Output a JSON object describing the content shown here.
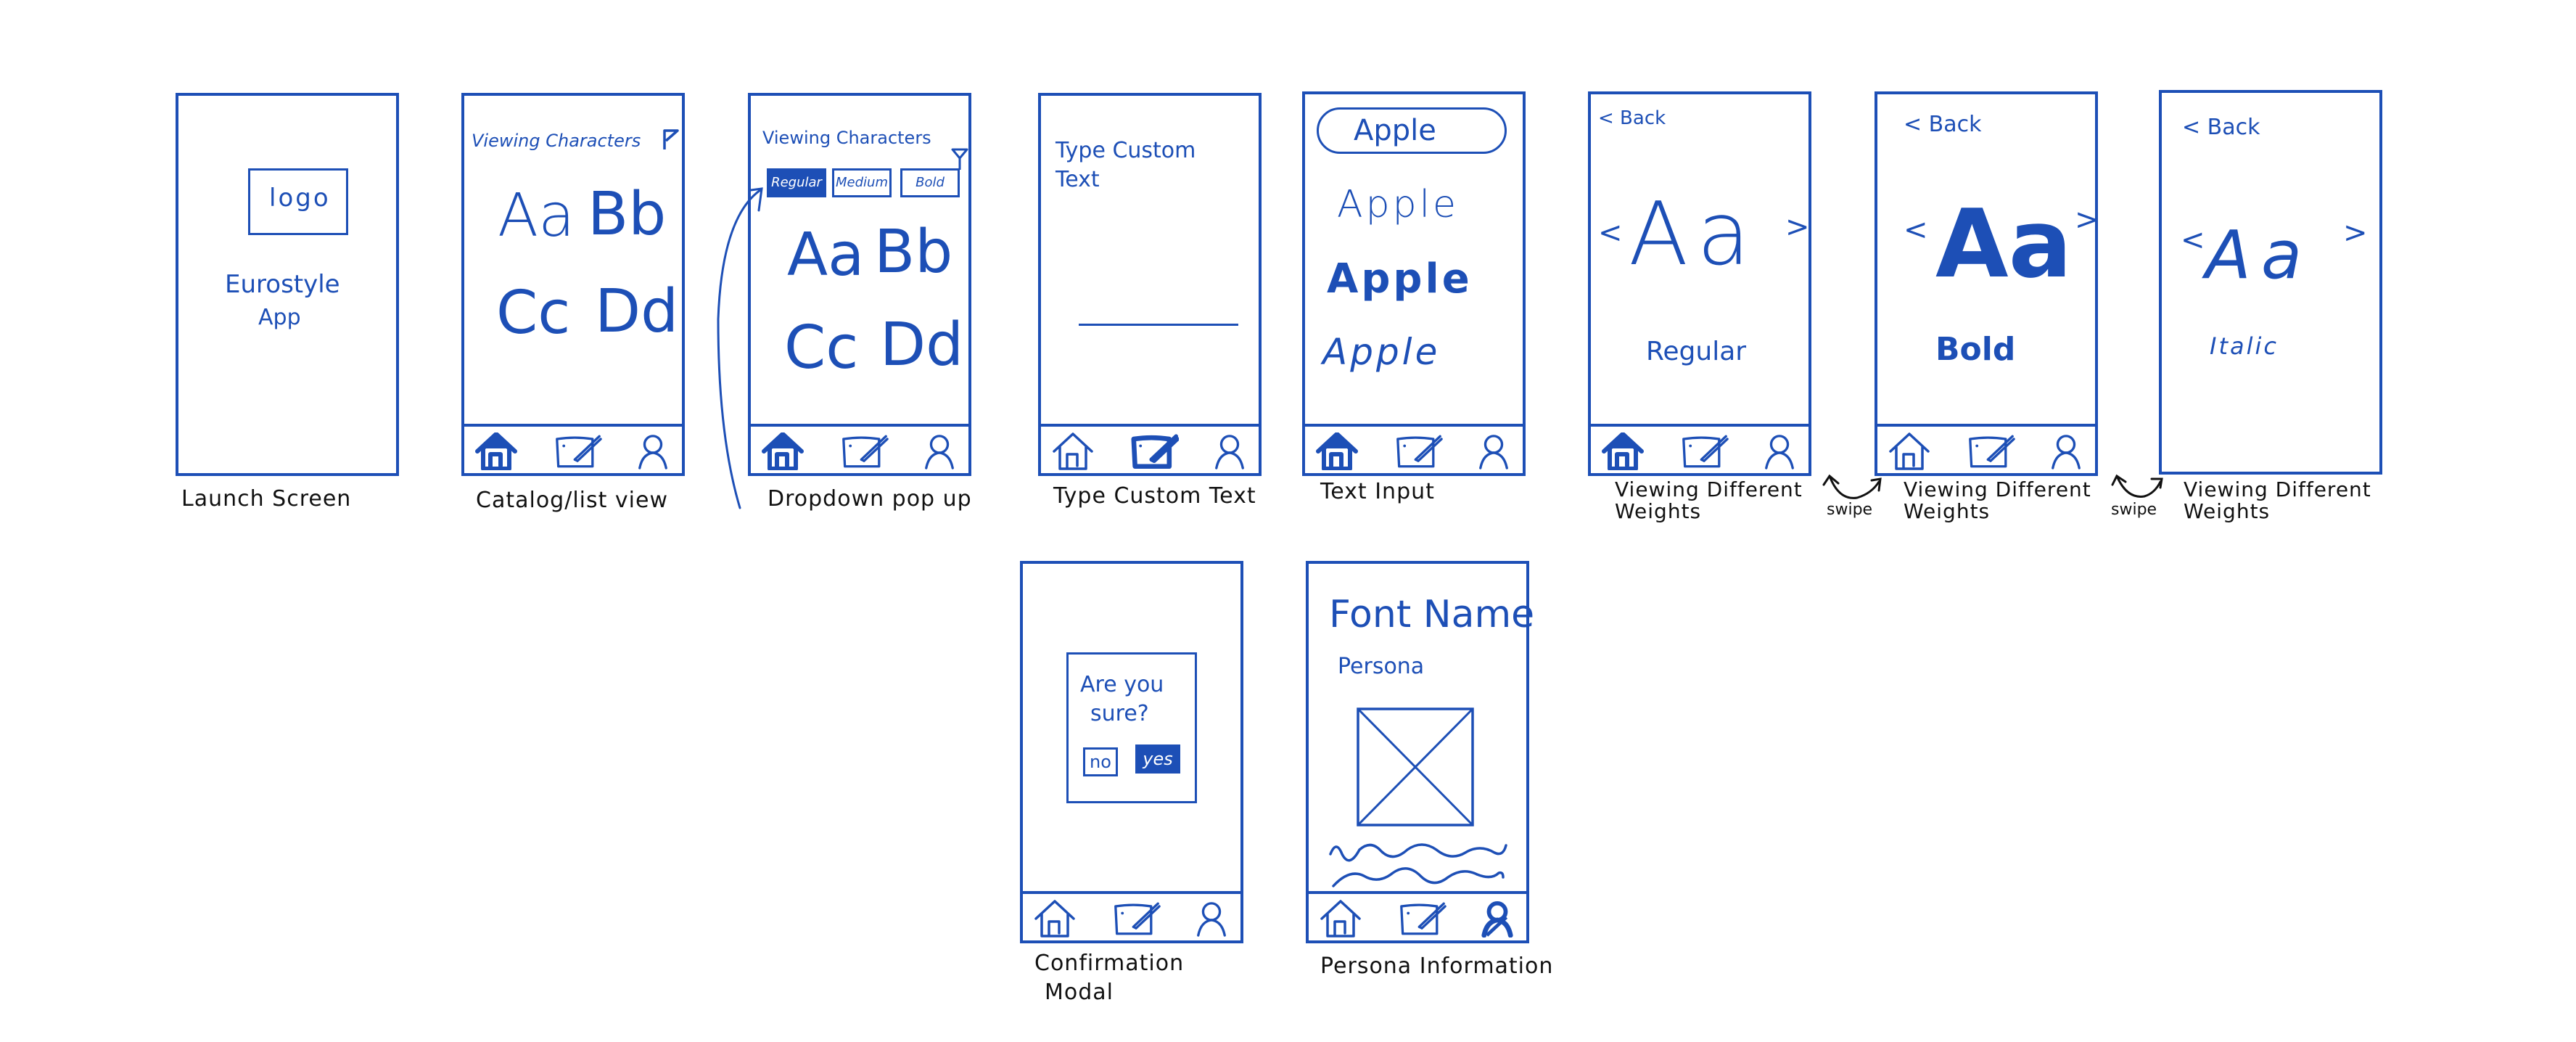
{
  "colors": {
    "stroke": "#1d4fb6",
    "caption": "#111111",
    "background": "#ffffff"
  },
  "tabbar": {
    "icons": [
      "home-icon",
      "edit-icon",
      "profile-icon"
    ]
  },
  "screens": {
    "launch": {
      "caption": "Launch Screen",
      "logo": "logo",
      "app_name_line1": "Eurostyle",
      "app_name_line2": "App"
    },
    "catalog": {
      "caption": "Catalog/list view",
      "header": "Viewing Characters",
      "glyphs": [
        "Aa",
        "Bb",
        "Cc",
        "Dd"
      ],
      "active_tab": "home"
    },
    "dropdown": {
      "caption": "Dropdown pop up",
      "header": "Viewing Characters",
      "options": [
        "Regular",
        "Medium",
        "Bold"
      ],
      "selected": "Regular",
      "glyphs": [
        "Aa",
        "Bb",
        "Cc",
        "Dd"
      ],
      "active_tab": "home"
    },
    "type_custom": {
      "caption": "Type Custom Text",
      "prompt": "Type Custom Text",
      "input_value": "",
      "active_tab": "edit"
    },
    "text_input": {
      "caption": "Text Input",
      "input_value": "Apple",
      "samples": [
        "Apple",
        "Apple",
        "Apple"
      ],
      "sample_styles": [
        "regular",
        "bold",
        "italic"
      ],
      "active_tab": "home"
    },
    "weight_regular": {
      "caption": "Viewing Different Weights",
      "back": "< Back",
      "glyph": "Aa",
      "weight": "Regular",
      "prev": "<",
      "next": ">",
      "active_tab": "home"
    },
    "weight_bold": {
      "caption": "Viewing Different Weights",
      "back": "< Back",
      "glyph": "Aa",
      "weight": "Bold",
      "prev": "<",
      "next": ">",
      "swipe_label": "swipe"
    },
    "weight_italic": {
      "caption": "Viewing Different Weights",
      "back": "< Back",
      "glyph": "Aa",
      "weight": "Italic",
      "prev": "<",
      "next": ">",
      "swipe_label": "swipe"
    },
    "confirm": {
      "caption_line1": "Confirmation",
      "caption_line2": "Modal",
      "question_line1": "Are you",
      "question_line2": "sure?",
      "no": "no",
      "yes": "yes"
    },
    "persona": {
      "caption": "Persona Information",
      "title": "Font Name",
      "subtitle": "Persona",
      "image": "image-placeholder",
      "active_tab": "profile"
    }
  }
}
